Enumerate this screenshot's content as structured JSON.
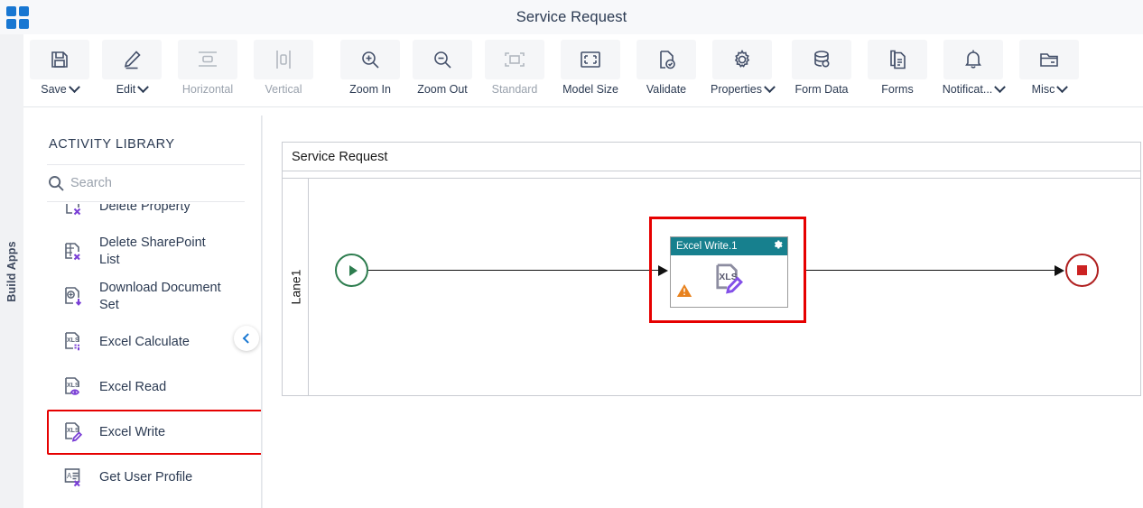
{
  "app": {
    "logo_icon": "grid-apps-icon",
    "title": "Service Request"
  },
  "left_rail": {
    "label": "Build Apps"
  },
  "toolbar": {
    "items": [
      {
        "label": "Save",
        "icon": "save-icon",
        "caret": true,
        "disabled": false
      },
      {
        "label": "Edit",
        "icon": "edit-pencil-icon",
        "caret": true,
        "disabled": false
      },
      {
        "label": "Horizontal",
        "icon": "horizontal-layout-icon",
        "caret": false,
        "disabled": true
      },
      {
        "label": "Vertical",
        "icon": "vertical-layout-icon",
        "caret": false,
        "disabled": true
      },
      {
        "label": "Zoom In",
        "icon": "zoom-in-icon",
        "caret": false,
        "disabled": false
      },
      {
        "label": "Zoom Out",
        "icon": "zoom-out-icon",
        "caret": false,
        "disabled": false
      },
      {
        "label": "Standard",
        "icon": "standard-size-icon",
        "caret": false,
        "disabled": true
      },
      {
        "label": "Model Size",
        "icon": "model-size-icon",
        "caret": false,
        "disabled": false
      },
      {
        "label": "Validate",
        "icon": "validate-icon",
        "caret": false,
        "disabled": false
      },
      {
        "label": "Properties",
        "icon": "gear-icon",
        "caret": true,
        "disabled": false
      },
      {
        "label": "Form Data",
        "icon": "database-icon",
        "caret": false,
        "disabled": false
      },
      {
        "label": "Forms",
        "icon": "document-icon",
        "caret": false,
        "disabled": false
      },
      {
        "label": "Notificat...",
        "icon": "bell-icon",
        "caret": true,
        "disabled": false
      },
      {
        "label": "Misc",
        "icon": "folder-icon",
        "caret": true,
        "disabled": false
      }
    ]
  },
  "library": {
    "title": "ACTIVITY LIBRARY",
    "search": {
      "placeholder": "Search",
      "value": "",
      "icon": "search-icon"
    },
    "collapse_icon": "chevron-left-icon",
    "items": [
      {
        "label": "Delete Property",
        "icon": "delete-property-icon",
        "selected": false,
        "clipped": true
      },
      {
        "label": "Delete SharePoint\nList",
        "icon": "delete-sharepoint-list-icon",
        "selected": false,
        "clipped": false
      },
      {
        "label": "Download Document\nSet",
        "icon": "download-document-set-icon",
        "selected": false,
        "clipped": false
      },
      {
        "label": "Excel Calculate",
        "icon": "excel-calculate-icon",
        "selected": false,
        "clipped": false
      },
      {
        "label": "Excel Read",
        "icon": "excel-read-icon",
        "selected": false,
        "clipped": false
      },
      {
        "label": "Excel Write",
        "icon": "excel-write-icon",
        "selected": true,
        "clipped": false
      },
      {
        "label": "Get User Profile",
        "icon": "get-user-profile-icon",
        "selected": false,
        "clipped": false
      }
    ]
  },
  "canvas": {
    "pool_title": "Service Request",
    "lane_label": "Lane1",
    "start_node": {
      "name": "start-event",
      "icon": "play-icon"
    },
    "end_node": {
      "name": "end-event",
      "icon": "stop-square-icon"
    },
    "task_node": {
      "title": "Excel Write.1",
      "icon": "excel-write-icon",
      "settings_icon": "gear-icon",
      "warning_icon": "warning-triangle-icon",
      "selected": true
    }
  },
  "colors": {
    "accent_blue": "#1877d2",
    "node_header_teal": "#17808e",
    "selection_red": "#e60000",
    "start_green": "#2e7d4f",
    "end_red": "#b02020",
    "warning_orange": "#e8821e",
    "icon_purple": "#7a3fd6",
    "text_dark": "#2b3a52",
    "text_muted": "#9aa2ad"
  }
}
